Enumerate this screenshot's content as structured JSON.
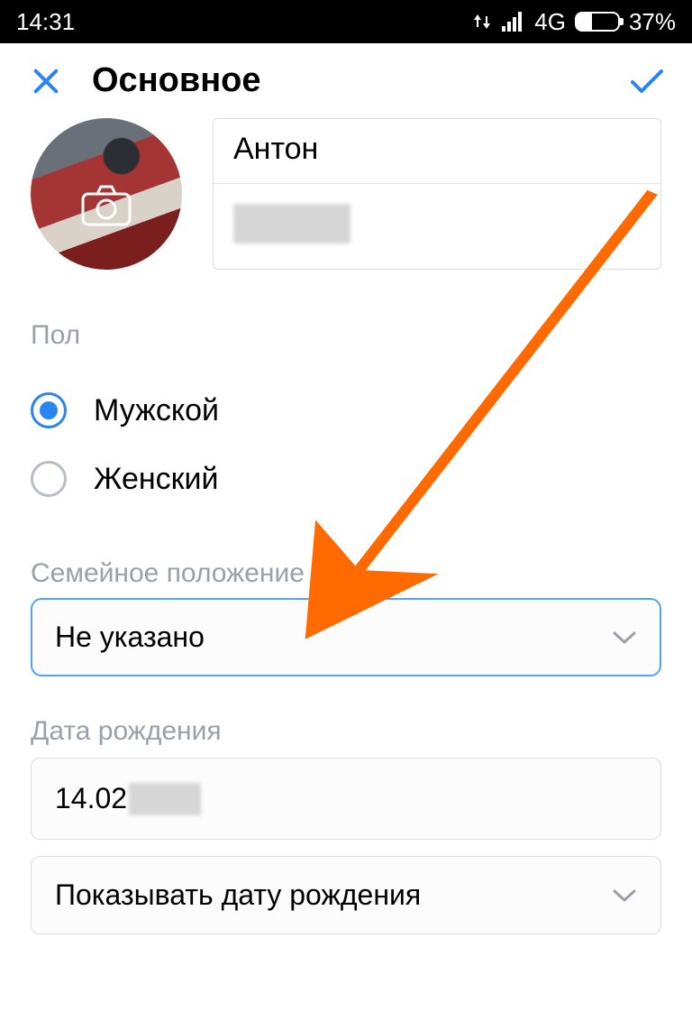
{
  "status": {
    "time": "14:31",
    "network": "4G",
    "battery": "37%"
  },
  "header": {
    "title": "Основное"
  },
  "profile": {
    "first_name": "Антон"
  },
  "gender": {
    "label": "Пол",
    "option_male": "Мужской",
    "option_female": "Женский"
  },
  "marital": {
    "label": "Семейное положение",
    "value": "Не указано"
  },
  "dob": {
    "label": "Дата рождения",
    "value_visible": "14.02",
    "visibility_label": "Показывать дату рождения"
  }
}
